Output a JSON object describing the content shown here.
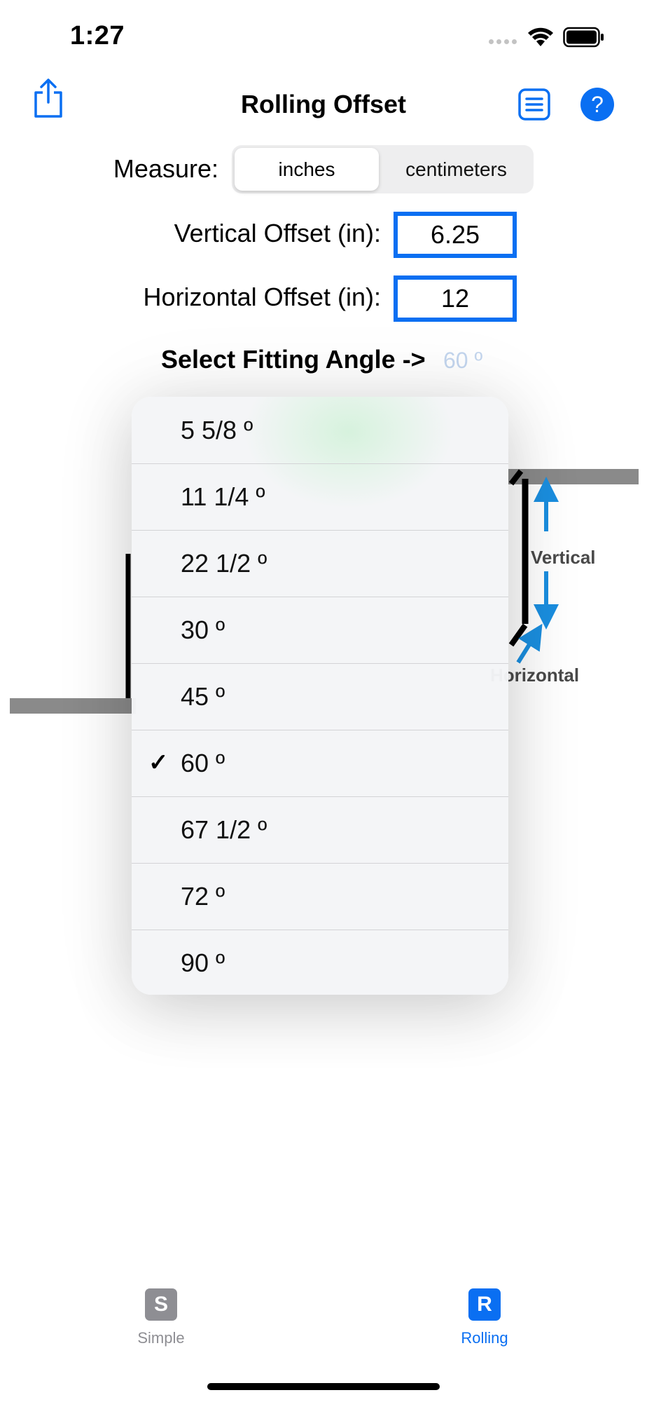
{
  "status_bar": {
    "time": "1:27"
  },
  "nav": {
    "title": "Rolling Offset",
    "share_icon": "share-icon",
    "list_icon": "list-icon",
    "help_icon": "question-mark-icon",
    "accent": "#0a6ff2"
  },
  "measure": {
    "label": "Measure:",
    "options": [
      "inches",
      "centimeters"
    ],
    "selected": "inches"
  },
  "vertical_offset": {
    "label": "Vertical Offset (in):",
    "value": "6.25"
  },
  "horizontal_offset": {
    "label": "Horizontal Offset (in):",
    "value": "12"
  },
  "fitting_angle": {
    "label": "Select Fitting Angle ->",
    "value": "60 º"
  },
  "diagram": {
    "vertical_label": "Vertical",
    "horizontal_label": "Horizontal"
  },
  "angle_menu": {
    "items": [
      {
        "label": "5 5/8 º",
        "checked": false
      },
      {
        "label": "11 1/4 º",
        "checked": false
      },
      {
        "label": "22 1/2 º",
        "checked": false
      },
      {
        "label": "30 º",
        "checked": false
      },
      {
        "label": "45 º",
        "checked": false
      },
      {
        "label": "60 º",
        "checked": true
      },
      {
        "label": "67 1/2 º",
        "checked": false
      },
      {
        "label": "72 º",
        "checked": false
      },
      {
        "label": "90 º",
        "checked": false
      }
    ],
    "check_mark": "✓"
  },
  "tabs": [
    {
      "icon_letter": "S",
      "label": "Simple",
      "active": false,
      "color": "#8e8e93"
    },
    {
      "icon_letter": "R",
      "label": "Rolling",
      "active": true,
      "color": "#0a6ff2"
    }
  ]
}
